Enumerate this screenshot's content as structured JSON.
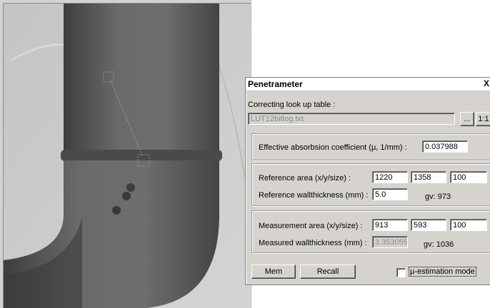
{
  "dialog": {
    "title": "Penetrameter",
    "close_glyph": "X",
    "lut_label": "Correcting look up table :",
    "lut_value": "LUT12bitlog.txt",
    "browse_label": "...",
    "one_to_one_label": "1:1",
    "absorption_label": "Effective absorbsion coefficient (µ, 1/mm) :",
    "absorption_value": "0.037988",
    "reference": {
      "area_label": "Reference area (x/y/size) :",
      "x": "1220",
      "y": "1358",
      "size": "100",
      "wall_label": "Reference wallthickness (mm) :",
      "wall_value": "5.0",
      "gv_label": "gv: 973"
    },
    "measurement": {
      "area_label": "Measurement area (x/y/size) :",
      "x": "913",
      "y": "593",
      "size": "100",
      "wall_label": "Measured wallthickness (mm) :",
      "wall_value": "3.353055",
      "gv_label": "gv: 1036"
    },
    "mem_label": "Mem",
    "recall_label": "Recall",
    "mu_mode_label": "µ-estimation mode",
    "mu_mode_checked": false
  },
  "colors": {
    "dialog_bg": "#d6d3ce",
    "pipe_dark": "#5a5a5a",
    "image_bg": "#c8c8c8"
  }
}
